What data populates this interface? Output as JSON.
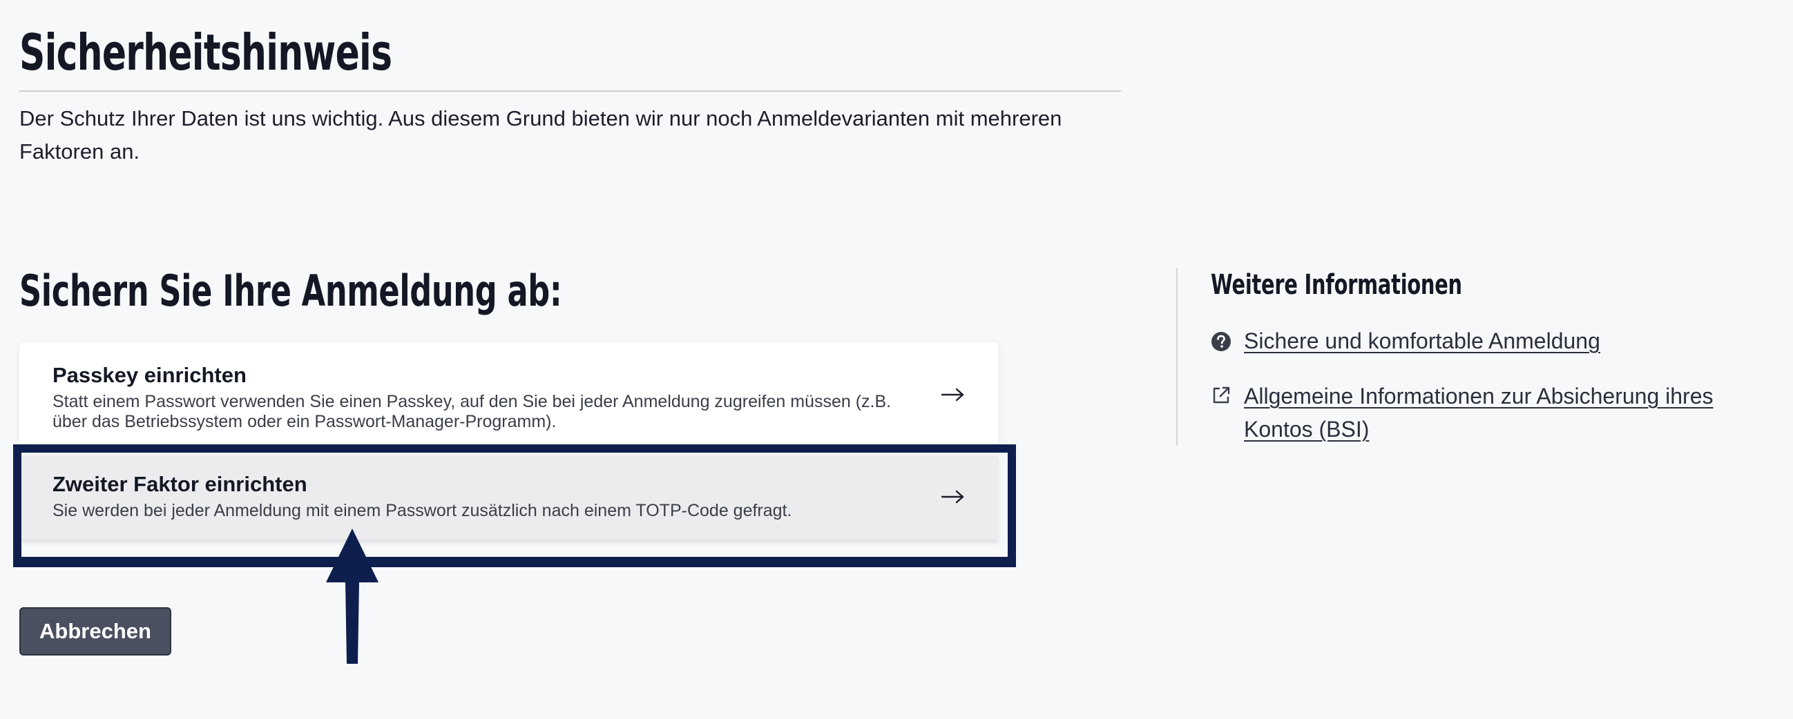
{
  "page": {
    "title": "Sicherheitshinweis",
    "intro": "Der Schutz Ihrer Daten ist uns wichtig. Aus diesem Grund bieten wir nur noch Anmeldevarianten mit mehreren Faktoren an."
  },
  "section": {
    "heading": "Sichern Sie Ihre Anmeldung ab:"
  },
  "options": [
    {
      "title": "Passkey einrichten",
      "description": "Statt einem Passwort verwenden Sie einen Passkey, auf den Sie bei jeder Anmeldung zugreifen müssen (z.B. über das Betriebssystem oder ein Passwort-Manager-Programm).",
      "icon": "arrow-right-icon"
    },
    {
      "title": "Zweiter Faktor einrichten",
      "description": "Sie werden bei jeder Anmeldung mit einem Passwort zusätzlich nach einem TOTP-Code gefragt.",
      "icon": "arrow-right-icon",
      "highlighted": true
    }
  ],
  "actions": {
    "cancel_label": "Abbrechen"
  },
  "sidebar": {
    "heading": "Weitere Informationen",
    "links": [
      {
        "label": "Sichere und komfortable Anmeldung",
        "icon": "question-circle-icon"
      },
      {
        "label": "Allgemeine Informationen zur Absicherung ihres Kontos (BSI)",
        "icon": "external-link-icon"
      }
    ]
  },
  "colors": {
    "background": "#f7f8fa",
    "highlight": "#0e1f4d",
    "button": "#4a505f",
    "text": "#141824"
  }
}
